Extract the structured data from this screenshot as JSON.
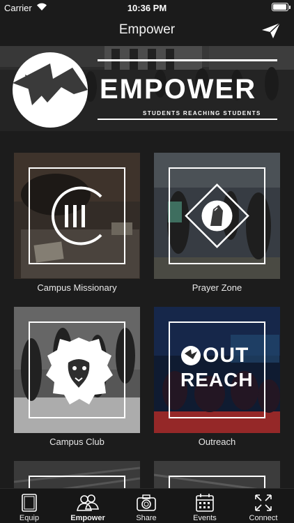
{
  "status_bar": {
    "carrier": "Carrier",
    "time": "10:36 PM",
    "battery_level": 0.95
  },
  "nav": {
    "title": "Empower",
    "send_icon": "paper-plane-icon"
  },
  "banner": {
    "wordmark": "EMPOWER",
    "tagline": "STUDENTS REACHING STUDENTS"
  },
  "tiles": [
    {
      "label": "Campus Missionary",
      "icon": "campus-missionary-logo"
    },
    {
      "label": "Prayer Zone",
      "icon": "praying-hands-logo"
    },
    {
      "label": "Campus Club",
      "icon": "lion-logo"
    },
    {
      "label": "Outreach",
      "icon": "outreach-logo",
      "logo_line1": "OUT",
      "logo_line2": "REACH"
    }
  ],
  "tabs": [
    {
      "label": "Equip",
      "icon": "book-icon"
    },
    {
      "label": "Empower",
      "icon": "people-icon",
      "active": true
    },
    {
      "label": "Share",
      "icon": "camera-icon"
    },
    {
      "label": "Events",
      "icon": "calendar-icon"
    },
    {
      "label": "Connect",
      "icon": "arrows-icon"
    }
  ],
  "colors": {
    "background": "#1c1c1c",
    "bar": "#1b1b1b",
    "text": "#ffffff"
  }
}
